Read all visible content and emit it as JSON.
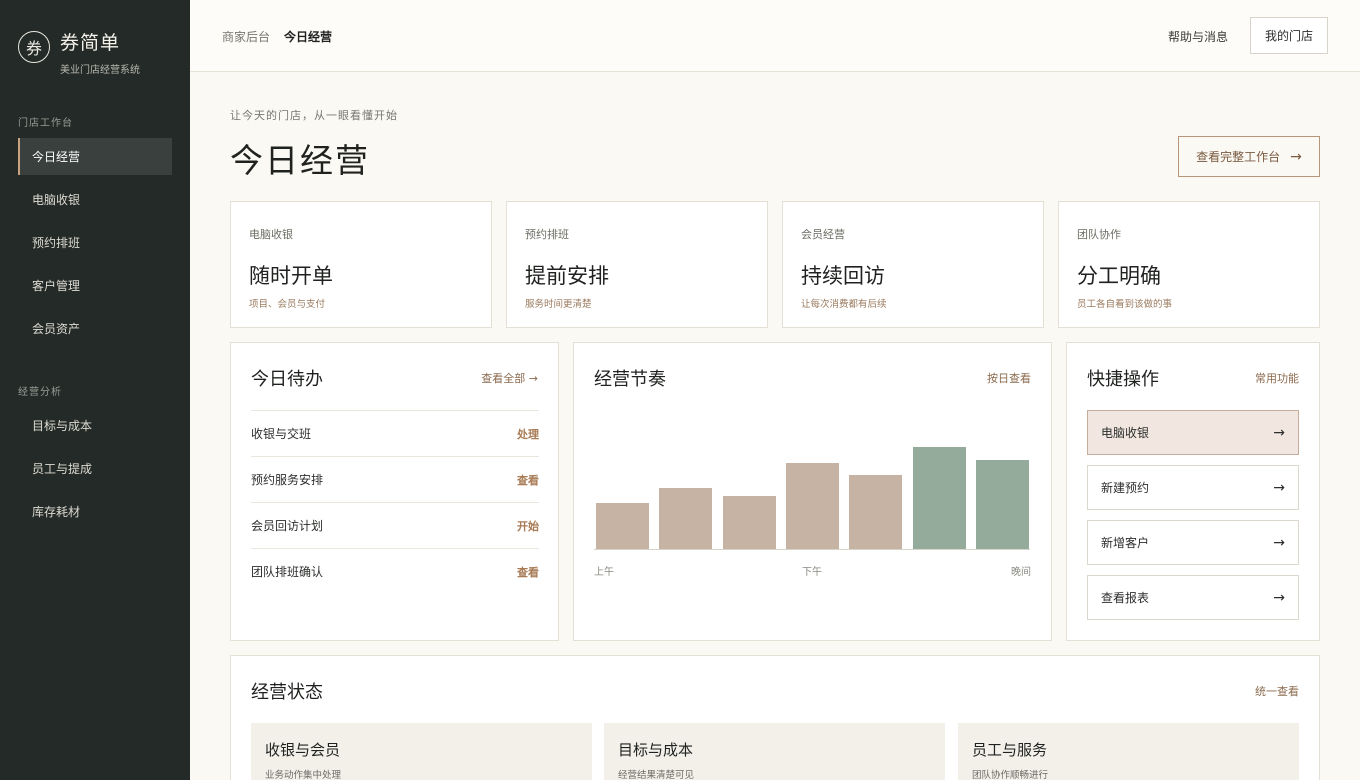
{
  "brand": {
    "logo_char": "券",
    "name": "券简单",
    "subtitle": "美业门店经营系统"
  },
  "sidebar": {
    "sections": [
      {
        "title": "门店工作台",
        "items": [
          "今日经营",
          "电脑收银",
          "预约排班",
          "客户管理",
          "会员资产"
        ]
      },
      {
        "title": "经营分析",
        "items": [
          "目标与成本",
          "员工与提成",
          "库存耗材"
        ]
      }
    ],
    "active_item": "今日经营"
  },
  "topbar": {
    "breadcrumb": [
      "商家后台",
      "今日经营"
    ],
    "help": "帮助与消息",
    "my_store": "我的门店"
  },
  "hero": {
    "subtitle": "让今天的门店，从一眼看懂开始",
    "title": "今日经营",
    "button": "查看完整工作台",
    "arrow": "→"
  },
  "feature_cards": [
    {
      "label": "电脑收银",
      "title": "随时开单",
      "desc": "项目、会员与支付"
    },
    {
      "label": "预约排班",
      "title": "提前安排",
      "desc": "服务时间更清楚"
    },
    {
      "label": "会员经营",
      "title": "持续回访",
      "desc": "让每次消费都有后续"
    },
    {
      "label": "团队协作",
      "title": "分工明确",
      "desc": "员工各自看到该做的事"
    }
  ],
  "todo": {
    "title": "今日待办",
    "link": "查看全部",
    "link_arrow": "→",
    "items": [
      {
        "text": "收银与交班",
        "action": "处理"
      },
      {
        "text": "预约服务安排",
        "action": "查看"
      },
      {
        "text": "会员回访计划",
        "action": "开始"
      },
      {
        "text": "团队排班确认",
        "action": "查看"
      }
    ]
  },
  "rhythm": {
    "title": "经营节奏",
    "link": "按日查看",
    "ticks": [
      "上午",
      "下午",
      "晚间"
    ],
    "colors": {
      "normal": "#c7b3a4",
      "highlight": "#94ab9b"
    }
  },
  "chart_data": {
    "type": "bar",
    "values": [
      46,
      61,
      53,
      86,
      74,
      102,
      89
    ],
    "highlight": [
      false,
      false,
      false,
      false,
      false,
      true,
      true
    ],
    "xticks": [
      "上午",
      "下午",
      "晚间"
    ]
  },
  "quick": {
    "title": "快捷操作",
    "link": "常用功能",
    "arrow": "→",
    "items": [
      "电脑收银",
      "新建预约",
      "新增客户",
      "查看报表"
    ]
  },
  "status": {
    "title": "经营状态",
    "link": "统一查看",
    "cards": [
      {
        "title": "收银与会员",
        "desc": "业务动作集中处理"
      },
      {
        "title": "目标与成本",
        "desc": "经营结果清楚可见"
      },
      {
        "title": "员工与服务",
        "desc": "团队协作顺畅进行"
      }
    ]
  }
}
